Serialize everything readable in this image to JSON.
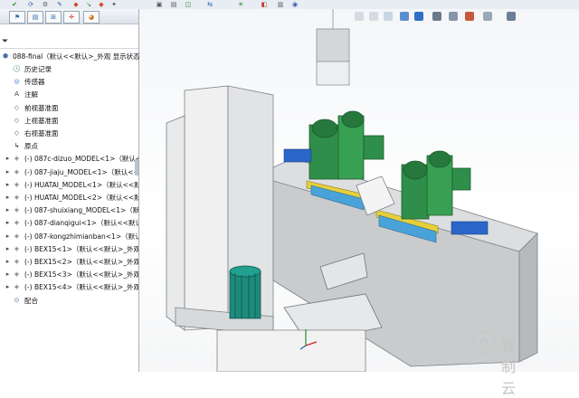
{
  "tree": {
    "root_label": "088-final（默认<<默认>_外观 显示状态",
    "items": [
      {
        "label": "历史记录",
        "icon": "history-icon"
      },
      {
        "label": "传感器",
        "icon": "sensor-icon"
      },
      {
        "label": "注解",
        "icon": "annotation-icon"
      },
      {
        "label": "前视基准面",
        "icon": "plane-icon"
      },
      {
        "label": "上视基准面",
        "icon": "plane-icon"
      },
      {
        "label": "右视基准面",
        "icon": "plane-icon"
      },
      {
        "label": "原点",
        "icon": "origin-icon"
      },
      {
        "label": "(-) 087c-dizuo_MODEL<1>（默认<",
        "icon": "part-icon"
      },
      {
        "label": "(-) 087-jiaju_MODEL<1>（默认<<",
        "icon": "part-icon"
      },
      {
        "label": "(-) HUATAI_MODEL<1>（默认<<默",
        "icon": "part-icon"
      },
      {
        "label": "(-) HUATAI_MODEL<2>（默认<<默",
        "icon": "part-icon"
      },
      {
        "label": "(-) 087-shuixiang_MODEL<1>（默认",
        "icon": "part-icon"
      },
      {
        "label": "(-) 087-dianqigui<1>（默认<<默认",
        "icon": "part-icon"
      },
      {
        "label": "(-) 087-kongzhimianban<1>（默认",
        "icon": "part-icon"
      },
      {
        "label": "(-) BEX15<1>（默认<<默认>_外观",
        "icon": "part-icon"
      },
      {
        "label": "(-) BEX15<2>（默认<<默认>_外观",
        "icon": "part-icon"
      },
      {
        "label": "(-) BEX15<3>（默认<<默认>_外观",
        "icon": "part-icon"
      },
      {
        "label": "(-) BEX15<4>（默认<<默认>_外观",
        "icon": "part-icon"
      },
      {
        "label": "配合",
        "icon": "mate-icon"
      }
    ]
  },
  "watermark": {
    "text": "智制云"
  },
  "colors": {
    "machine_green": "#2f8f4a",
    "teal_motor": "#1e8a7c",
    "base_gray": "#c9cbcd",
    "cabinet_white": "#f0f0f0",
    "rail_yellow": "#e7cf3a",
    "motor_blue": "#2b66c9"
  }
}
